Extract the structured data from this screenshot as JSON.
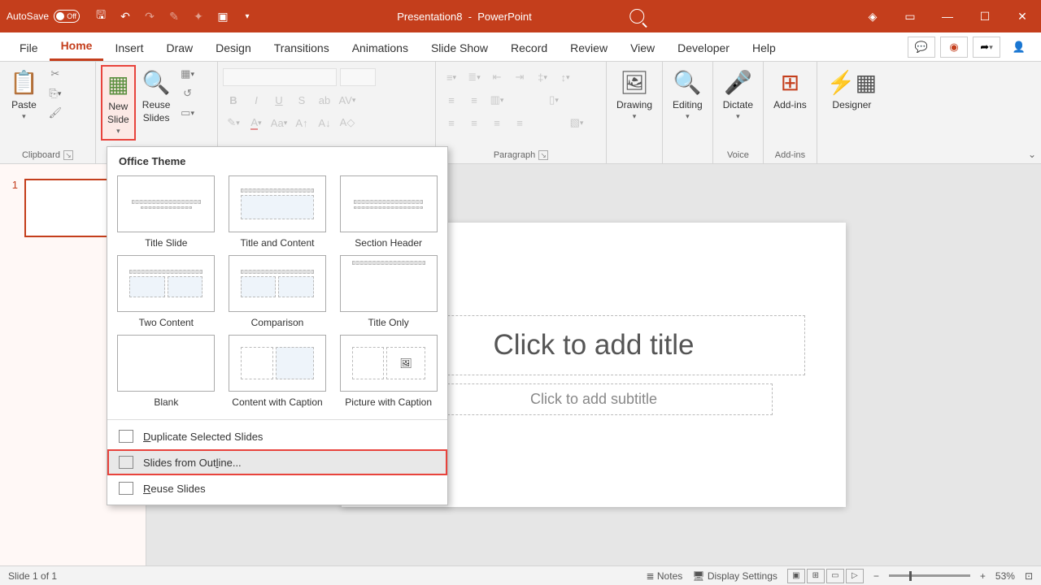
{
  "titlebar": {
    "autosave_label": "AutoSave",
    "autosave_state": "Off",
    "doc_name": "Presentation8",
    "app_name": "PowerPoint"
  },
  "tabs": [
    "File",
    "Home",
    "Insert",
    "Draw",
    "Design",
    "Transitions",
    "Animations",
    "Slide Show",
    "Record",
    "Review",
    "View",
    "Developer",
    "Help"
  ],
  "active_tab": "Home",
  "ribbon": {
    "clipboard": {
      "paste": "Paste",
      "label": "Clipboard"
    },
    "slides": {
      "new_slide": "New\nSlide",
      "reuse": "Reuse\nSlides"
    },
    "paragraph_label": "Paragraph",
    "drawing": "Drawing",
    "editing": "Editing",
    "dictate": "Dictate",
    "voice_label": "Voice",
    "addins": "Add-ins",
    "addins_label": "Add-ins",
    "designer": "Designer"
  },
  "dropdown": {
    "heading": "Office Theme",
    "layouts": [
      "Title Slide",
      "Title and Content",
      "Section Header",
      "Two Content",
      "Comparison",
      "Title Only",
      "Blank",
      "Content with Caption",
      "Picture with Caption"
    ],
    "duplicate": "Duplicate Selected Slides",
    "outline": "Slides from Outline...",
    "reuse": "Reuse Slides"
  },
  "slide": {
    "title_ph": "Click to add title",
    "sub_ph": "Click to add subtitle",
    "thumb_num": "1"
  },
  "status": {
    "slide_info": "Slide 1 of 1",
    "notes": "Notes",
    "display": "Display Settings",
    "zoom": "53%"
  }
}
